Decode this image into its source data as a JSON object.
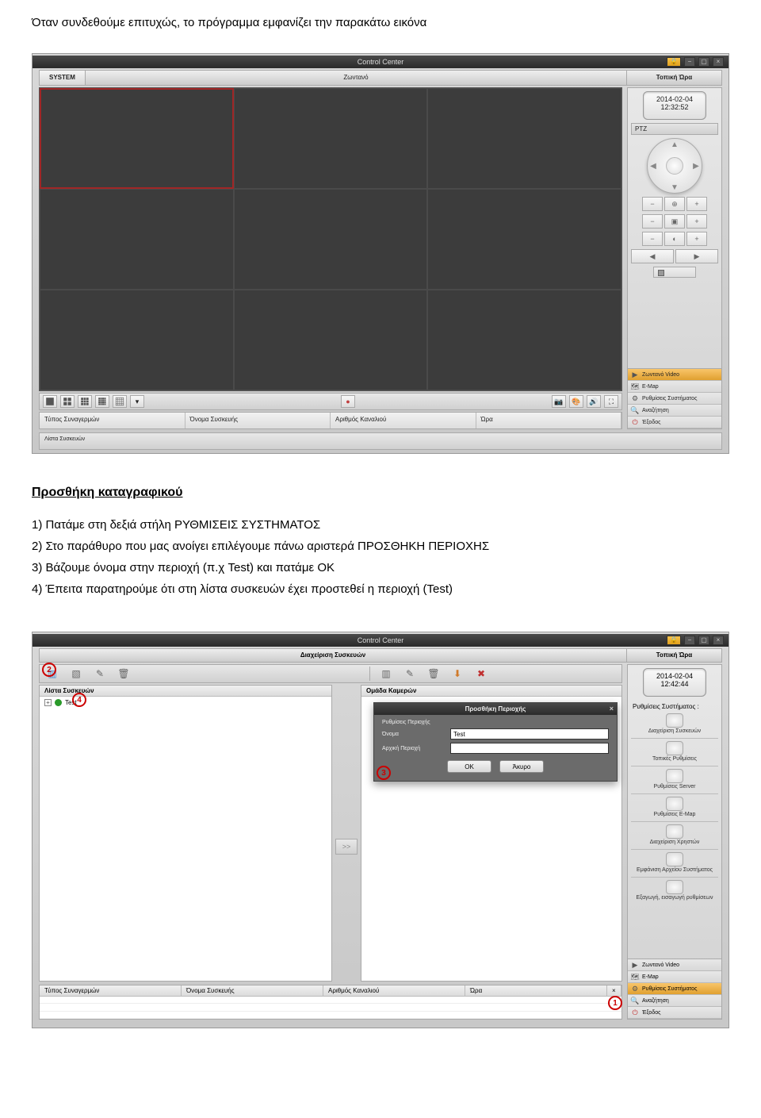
{
  "intro": "Όταν συνδεθούμε επιτυχώς, το πρόγραμμα εμφανίζει την παρακάτω εικόνα",
  "section_heading": "Προσθήκη καταγραφικού",
  "steps": [
    "1) Πατάμε στη δεξιά στήλη ΡΥΘΜΙΣΕΙΣ ΣΥΣΤΗΜΑΤΟΣ",
    "2) Στο παράθυρο που μας ανοίγει επιλέγουμε πάνω αριστερά ΠΡΟΣΘΗΚΗ ΠΕΡΙΟΧΗΣ",
    "3) Βάζουμε όνομα στην περιοχή (π.χ Test) και πατάμε OK",
    "4) Έπειτα παρατηρούμε ότι στη λίστα συσκευών έχει προστεθεί η περιοχή (Test)"
  ],
  "ss1": {
    "title": "Control Center",
    "tab_system": "SYSTEM",
    "tab_live": "Ζωντανό",
    "tab_time": "Τοπική Ώρα",
    "clock_date": "2014-02-04",
    "clock_time": "12:32:52",
    "ptz_label": "PTZ",
    "table_headers": [
      "Τύπος Συναγερμών",
      "Όνομα Συσκευής",
      "Αριθμός Καναλιού",
      "Ώρα"
    ],
    "status": "Λίστα Συσκευών",
    "menu": [
      {
        "label": "Ζωντανό Video",
        "active": true,
        "icon": "play"
      },
      {
        "label": "E-Map",
        "active": false,
        "icon": "map"
      },
      {
        "label": "Ρυθμίσεις Συστήματος",
        "active": false,
        "icon": "gear"
      },
      {
        "label": "Αναζήτηση",
        "active": false,
        "icon": "search"
      },
      {
        "label": "Έξοδος",
        "active": false,
        "icon": "exit"
      }
    ]
  },
  "ss2": {
    "title": "Control Center",
    "main_tab": "Διαχείριση Συσκευών",
    "time_tab": "Τοπική Ώρα",
    "clock_date": "2014-02-04",
    "clock_time": "12:42:44",
    "left_header": "Λίστα Συσκευών",
    "tree_item": "Test",
    "right_header": "Ομάδα Καμερών",
    "mid_btn": ">>",
    "rp_title": "Ρυθμίσεις Συστήματος :",
    "rp_items": [
      "Διαχείριση Συσκευών",
      "Τοπικές Ρυθμίσεις",
      "Ρυθμίσεις Server",
      "Ρυθμίσεις E-Map",
      "Διαχείριση Χρηστών",
      "Εμφάνιση Αρχείου Συστήματος",
      "Εξαγωγή, εισαγωγή ρυθμίσεων"
    ],
    "dialog": {
      "title": "Προσθήκη Περιοχής",
      "section": "Ρυθμίσεις Περιοχής",
      "name_label": "Όνομα",
      "name_value": "Test",
      "parent_label": "Αρχική Περιοχή",
      "ok": "OK",
      "cancel": "Άκυρο"
    },
    "table_headers": [
      "Τύπος Συναγερμών",
      "Όνομα Συσκευής",
      "Αριθμός Καναλιού",
      "Ώρα"
    ],
    "menu": [
      {
        "label": "Ζωντανό Video",
        "active": false,
        "icon": "play"
      },
      {
        "label": "E-Map",
        "active": false,
        "icon": "map"
      },
      {
        "label": "Ρυθμίσεις Συστήματος",
        "active": true,
        "icon": "gear"
      },
      {
        "label": "Αναζήτηση",
        "active": false,
        "icon": "search"
      },
      {
        "label": "Έξοδος",
        "active": false,
        "icon": "exit"
      }
    ],
    "callouts": {
      "c1": "1",
      "c2": "2",
      "c3": "3",
      "c4": "4"
    }
  }
}
